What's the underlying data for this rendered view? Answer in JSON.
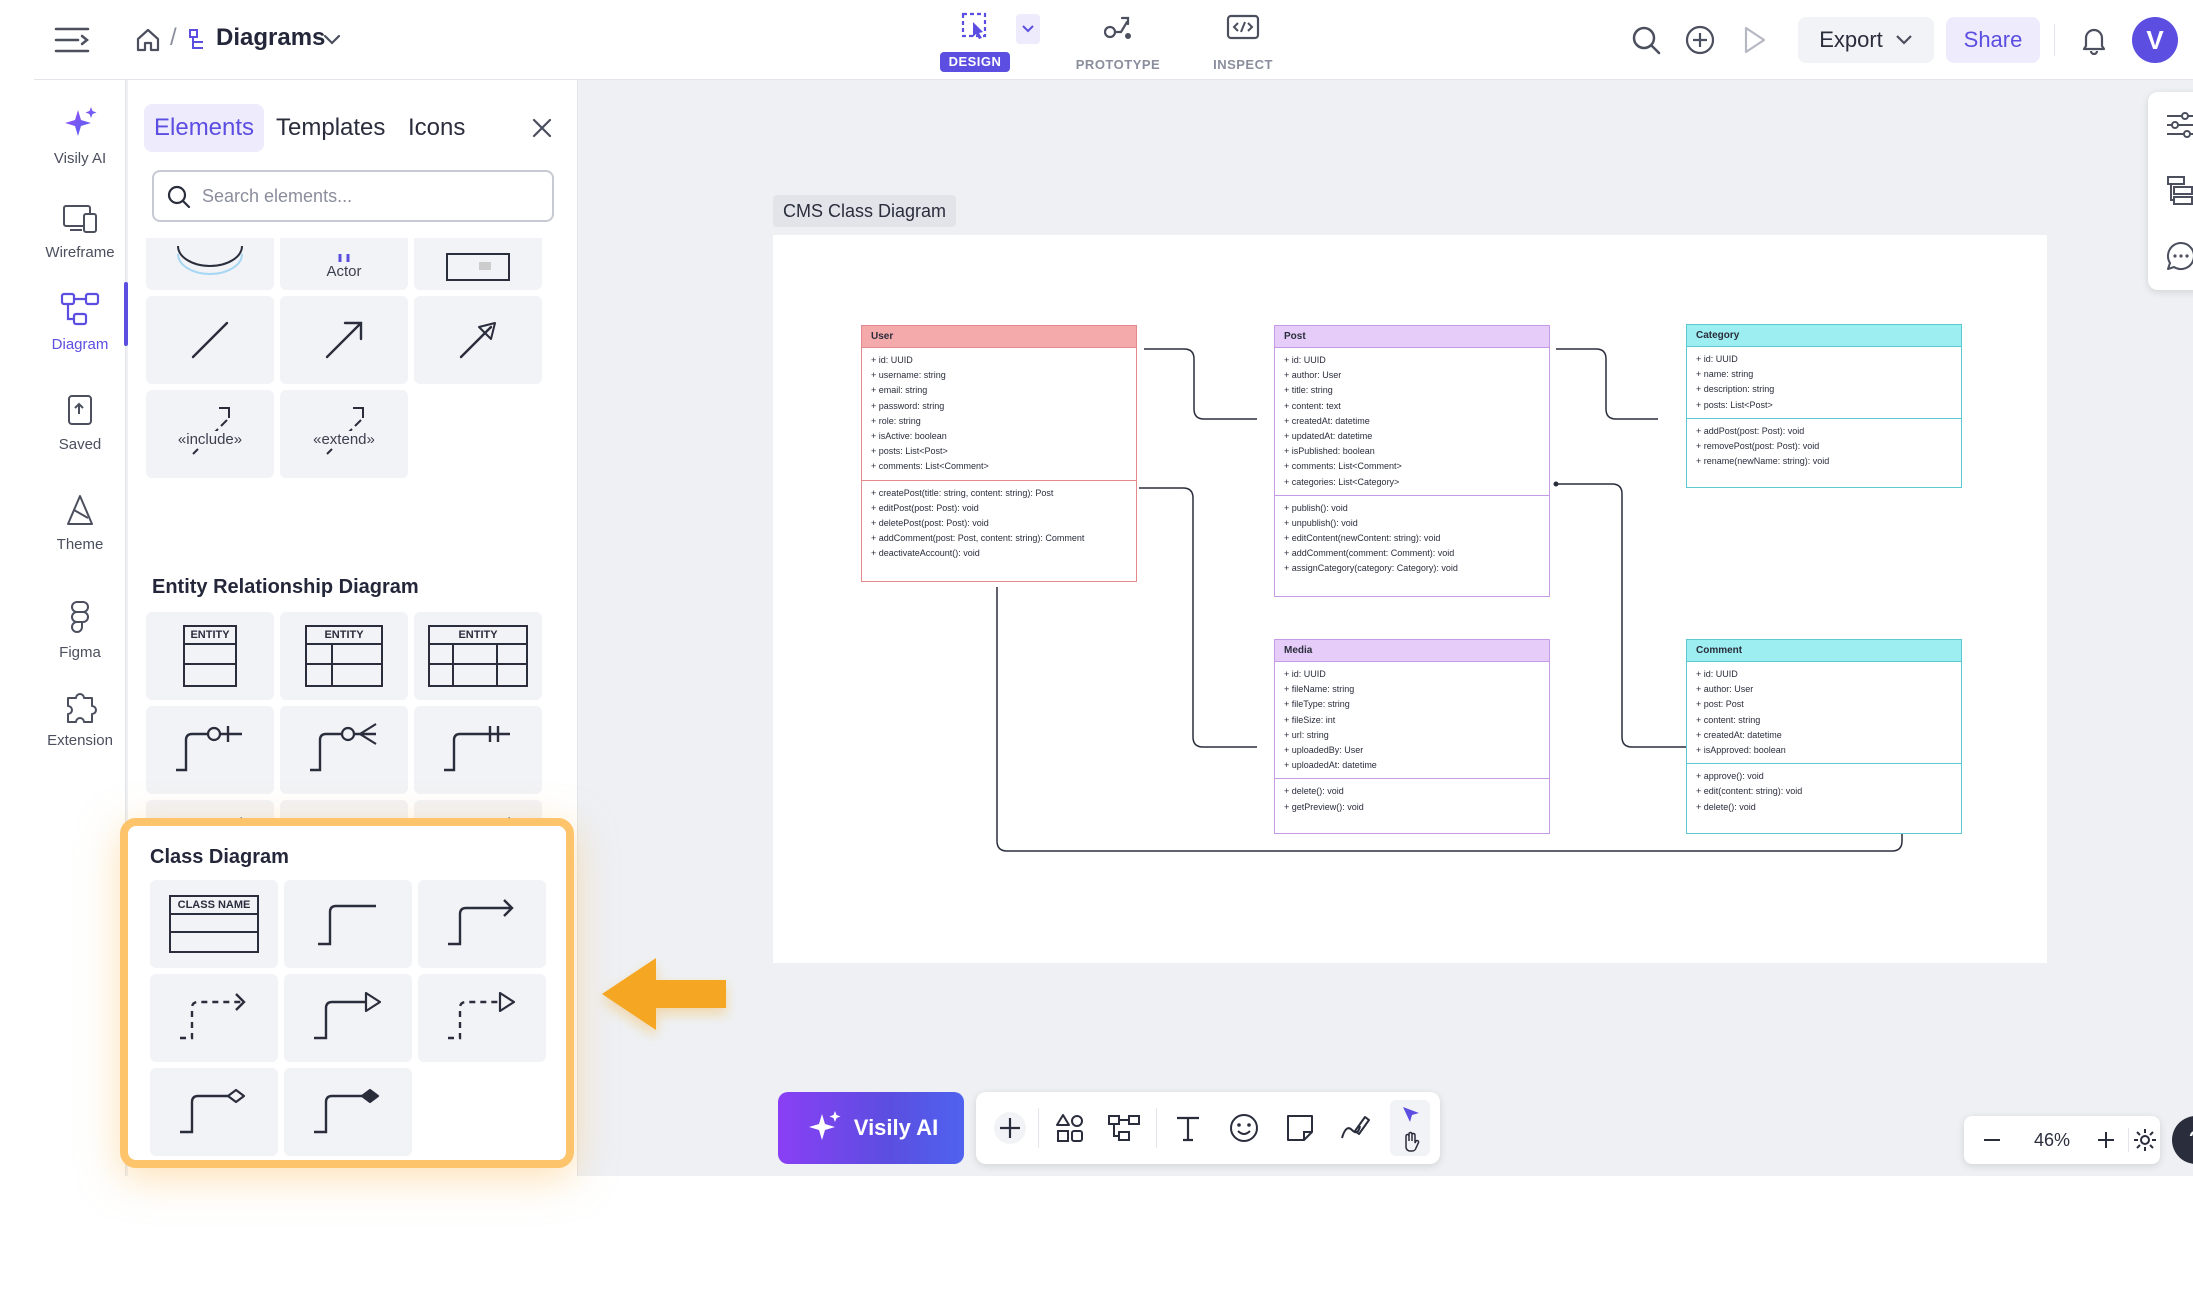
{
  "topbar": {
    "breadcrumb": "Diagrams",
    "modes": [
      {
        "label": "DESIGN",
        "active": true
      },
      {
        "label": "PROTOTYPE",
        "active": false
      },
      {
        "label": "INSPECT",
        "active": false
      }
    ],
    "export_label": "Export",
    "share_label": "Share",
    "avatar_letter": "V"
  },
  "rail": {
    "items": [
      {
        "label": "Visily AI",
        "icon": "sparkle-icon"
      },
      {
        "label": "Wireframe",
        "icon": "devices-icon"
      },
      {
        "label": "Diagram",
        "icon": "diagram-icon",
        "active": true
      },
      {
        "label": "Saved",
        "icon": "saved-icon"
      },
      {
        "label": "Theme",
        "icon": "theme-icon"
      },
      {
        "label": "Figma",
        "icon": "figma-icon"
      },
      {
        "label": "Extension",
        "icon": "puzzle-icon"
      }
    ]
  },
  "panel": {
    "tabs": [
      "Elements",
      "Templates",
      "Icons"
    ],
    "search_placeholder": "Search elements...",
    "actor_label": "Actor",
    "include_label": "«include»",
    "extend_label": "«extend»",
    "erd_title": "Entity Relationship Diagram",
    "entity_label": "ENTITY",
    "class_title": "Class Diagram",
    "class_name_label": "CLASS NAME"
  },
  "canvas": {
    "frame_label": "CMS Class Diagram",
    "classes": {
      "user": {
        "name": "User",
        "attrs": [
          "+ id: UUID",
          "+ username: string",
          "+ email: string",
          "+ password: string",
          "+ role: string",
          "+ isActive: boolean",
          "+ posts: List<Post>",
          "+ comments: List<Comment>"
        ],
        "methods": [
          "+ createPost(title: string, content: string): Post",
          "+ editPost(post: Post): void",
          "+ deletePost(post: Post): void",
          "+ addComment(post: Post, content: string): Comment",
          "+ deactivateAccount(): void"
        ]
      },
      "post": {
        "name": "Post",
        "attrs": [
          "+ id: UUID",
          "+ author: User",
          "+ title: string",
          "+ content: text",
          "+ createdAt: datetime",
          "+ updatedAt: datetime",
          "+ isPublished: boolean",
          "+ comments: List<Comment>",
          "+ categories: List<Category>"
        ],
        "methods": [
          "+ publish(): void",
          "+ unpublish(): void",
          "+ editContent(newContent: string): void",
          "+ addComment(comment: Comment): void",
          "+ assignCategory(category: Category): void"
        ]
      },
      "category": {
        "name": "Category",
        "attrs": [
          "+ id: UUID",
          "+ name: string",
          "+ description: string",
          "+ posts: List<Post>"
        ],
        "methods": [
          "+ addPost(post: Post): void",
          "+ removePost(post: Post): void",
          "+ rename(newName: string): void"
        ]
      },
      "media": {
        "name": "Media",
        "attrs": [
          "+ id: UUID",
          "+ fileName: string",
          "+ fileType: string",
          "+ fileSize: int",
          "+ url: string",
          "+ uploadedBy: User",
          "+ uploadedAt: datetime"
        ],
        "methods": [
          "+ delete(): void",
          "+ getPreview(): void"
        ]
      },
      "comment": {
        "name": "Comment",
        "attrs": [
          "+ id: UUID",
          "+ author: User",
          "+ post: Post",
          "+ content: string",
          "+ createdAt: datetime",
          "+ isApproved: boolean"
        ],
        "methods": [
          "+ approve(): void",
          "+ edit(content: string): void",
          "+ delete(): void"
        ]
      }
    },
    "colors": {
      "user": "#f4a9ab",
      "post": "#d8b4f2",
      "category": "#7ee2e2",
      "media": "#d8b4f2",
      "comment": "#7ee2e2"
    }
  },
  "bottom": {
    "ai_label": "Visily AI",
    "zoom": "46%",
    "help": "?"
  },
  "colors": {
    "accent": "#5b4ee0",
    "highlight": "#fdc46b",
    "arrow": "#f5a623"
  }
}
